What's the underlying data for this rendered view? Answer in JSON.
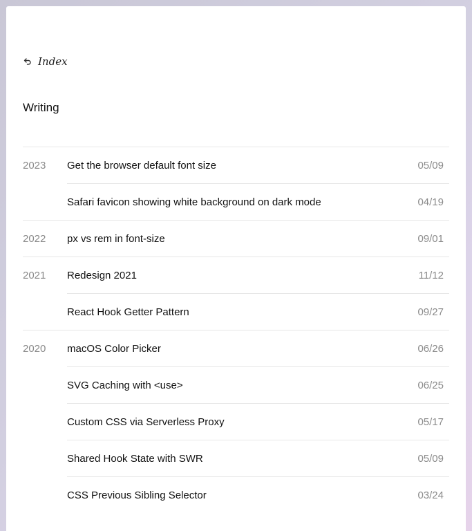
{
  "nav": {
    "back_label": "Index",
    "back_icon": "return-arrow-icon"
  },
  "heading": "Writing",
  "colors": {
    "text": "#111111",
    "muted": "#8a8a8a",
    "divider": "#e7e7e7",
    "background": "#ffffff"
  },
  "posts": [
    {
      "year": "2023",
      "title": "Get the browser default font size",
      "date": "05/09"
    },
    {
      "year": "",
      "title": "Safari favicon showing white background on dark mode",
      "date": "04/19"
    },
    {
      "year": "2022",
      "title": "px vs rem in font-size",
      "date": "09/01"
    },
    {
      "year": "2021",
      "title": "Redesign 2021",
      "date": "11/12"
    },
    {
      "year": "",
      "title": "React Hook Getter Pattern",
      "date": "09/27"
    },
    {
      "year": "2020",
      "title": "macOS Color Picker",
      "date": "06/26"
    },
    {
      "year": "",
      "title": "SVG Caching with <use>",
      "date": "06/25"
    },
    {
      "year": "",
      "title": "Custom CSS via Serverless Proxy",
      "date": "05/17"
    },
    {
      "year": "",
      "title": "Shared Hook State with SWR",
      "date": "05/09"
    },
    {
      "year": "",
      "title": "CSS Previous Sibling Selector",
      "date": "03/24"
    }
  ]
}
